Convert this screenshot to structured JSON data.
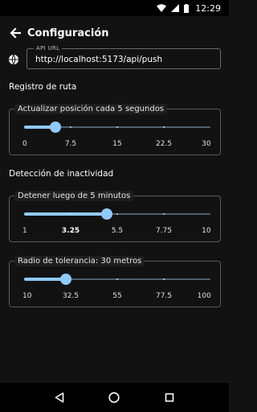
{
  "status_bar": {
    "time": "12:29"
  },
  "app_bar": {
    "title": "Configuración"
  },
  "api": {
    "label": "API URL",
    "value": "http://localhost:5173/api/push"
  },
  "sections": {
    "route_log": "Registro de ruta",
    "inactivity": "Detección de inactividad"
  },
  "sliders": [
    {
      "label": "Actualizar posición cada 5 segundos",
      "min": 0,
      "max": 30,
      "value": 5,
      "ticks": [
        "0",
        "7.5",
        "15",
        "22.5",
        "30"
      ],
      "active_tick": -1
    },
    {
      "label": "Detener luego de 5 minutos",
      "min": 1,
      "max": 10,
      "value": 5,
      "ticks": [
        "1",
        "3.25",
        "5.5",
        "7.75",
        "10"
      ],
      "active_tick": 1
    },
    {
      "label": "Radio de tolerancia: 30 metros",
      "min": 10,
      "max": 100,
      "value": 30,
      "ticks": [
        "10",
        "32.5",
        "55",
        "77.5",
        "100"
      ],
      "active_tick": -1
    }
  ],
  "icons": {
    "back": "arrow-left-icon",
    "globe": "globe-icon",
    "wifi": "wifi-icon",
    "signal": "signal-icon",
    "battery": "battery-icon",
    "nav_back": "triangle-back-icon",
    "nav_home": "circle-home-icon",
    "nav_recents": "square-recents-icon"
  },
  "colors": {
    "accent": "#90caf9",
    "background": "#121212",
    "track": "#4e5f70"
  }
}
